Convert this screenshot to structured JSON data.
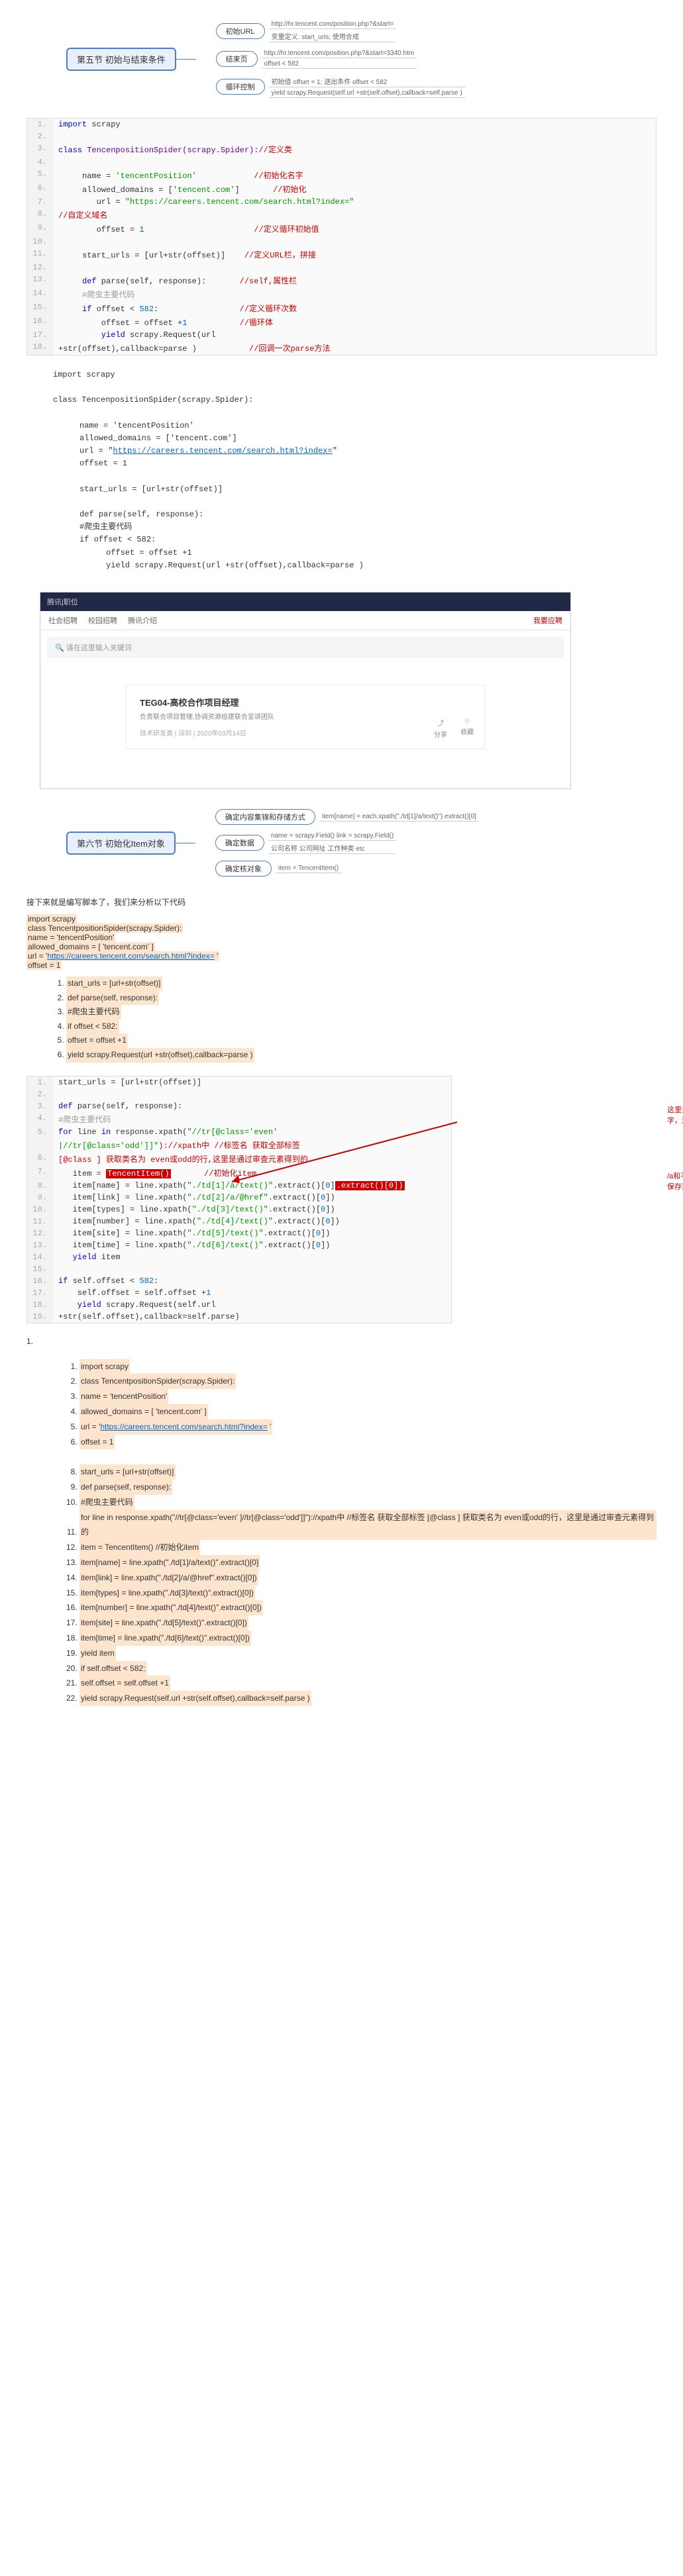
{
  "mindmap1": {
    "root": "第五节 初始与结束条件",
    "n1": "初始URL",
    "n1s1": "http://hr.tencent.com/position.php?&start=",
    "n1s2": "变量定义: start_urls; 使用合成",
    "n2": "结束页",
    "n2s1": "http://hr.tencent.com/position.php?&start=3340.htm",
    "n2s2": "offset < 582",
    "n3": "循环控制",
    "n3s1": "初始值 offset = 1; 送出条件 offset < 582",
    "n3s2": "yield scrapy.Request(self.url +str(self.offset),callback=self.parse )"
  },
  "code1": {
    "l1a": "import",
    "l1b": " scrapy",
    "l3a": "class",
    "l3b": " TencenpositionSpider(scrapy.Spider):",
    "l3c": "//定义类",
    "l5a": "     name = ",
    "l5b": "'tencentPosition'",
    "l5c": "//初始化名字",
    "l6a": "     allowed_domains = [",
    "l6b": "'tencent.com'",
    "l6c": "]       ",
    "l6d": "//初始化",
    "l7a": "        url = ",
    "l7b": "\"https://careers.tencent.com/search.html?index=\"",
    "l8a": "//自定义域名",
    "l9a": "        offset = ",
    "l9b": "1",
    "l9c": "                       ",
    "l9d": "//定义循环初始值",
    "l11a": "     start_urls = [url+str(offset)]    ",
    "l11b": "//定义URL栏，拼接",
    "l13a": "     def",
    "l13b": " parse(self, response):       ",
    "l13c": "//self,属性栏",
    "l14a": "     #爬虫主要代码",
    "l15a": "     if",
    "l15b": " offset < ",
    "l15c": "582",
    "l15d": ":                 ",
    "l15e": "//定义循环次数",
    "l16a": "         offset = offset +",
    "l16b": "1",
    "l16c": "           ",
    "l16d": "//循环体",
    "l17a": "         yield",
    "l17b": " scrapy.Request(url",
    "l18a": "+str(offset),callback=parse )           ",
    "l18b": "//回调一次parse方法"
  },
  "plaincode1": {
    "l1": "import scrapy",
    "l2": "class TencenpositionSpider(scrapy.Spider):",
    "l3": "name = 'tencentPosition'",
    "l4": "allowed_domains = ['tencent.com']",
    "l5pre": "url = \"",
    "l5link": "https://careers.tencent.com/search.html?index=",
    "l5post": "\"",
    "l6": "offset = 1",
    "l7": "start_urls = [url+str(offset)]",
    "l8": "def parse(self, response):",
    "l9": "#爬虫主要代码",
    "l10": "if offset < 582:",
    "l11": "offset = offset +1",
    "l12": "yield scrapy.Request(url +str(offset),callback=parse )"
  },
  "browser": {
    "tab": "腾讯|职位",
    "menu1": "社会招聘",
    "menu2": "校园招聘",
    "menu3": "腾讯介绍",
    "btn": "我要应聘",
    "search": "请在这里输入关键词",
    "card_title": "TEG04-高校合作项目经理",
    "card_desc": "负责联合项目管理,协调资源组建联合宣讲团队",
    "card_meta": "技术研发类 | 深圳 | 2020年03月14日",
    "icon1": "分享",
    "icon2": "收藏"
  },
  "mindmap2": {
    "root": "第六节 初始化Item对象",
    "n1": "确定内容集锦和存储方式",
    "n1s1": "item[name] = each.xpath(\"./td[1]/a/text()\").extract()[0]",
    "n2": "确定数据",
    "n2s1": "name = scrapy.Field() link = scrapy.Field()",
    "n2s2": "公司名称 公司网址 工作种类 etc",
    "n3": "确定核对象",
    "n3s1": "item = TencentItem()"
  },
  "para1": "接下来就是编写脚本了，我们来分析以下代码",
  "hlblock": {
    "l1": "import scrapy",
    "l2": "class TencentpositionSpider(scrapy.Spider):",
    "l3": "name = 'tencentPosition'",
    "l4": "allowed_domains = [ 'tencent.com' ]",
    "l5a": "url = '",
    "l5b": "https://careers.tencent.com/search.html?index=",
    "l5c": " '",
    "l6": "offset = 1"
  },
  "steps1": {
    "s1": "start_urls = [url+str(offset)]",
    "s2": "def parse(self, response):",
    "s3": "#爬虫主要代码",
    "s4": "if offset < 582:",
    "s5": "offset = offset +1",
    "s6": "yield scrapy.Request(url +str(offset),callback=parse )"
  },
  "code2": {
    "l1": "start_urls = [url+str(offset)]",
    "l3a": "def",
    "l3b": " parse(self, response):",
    "l4": "#爬虫主要代码",
    "l5a": "for",
    "l5b": " line ",
    "l5c": "in",
    "l5d": " response.xpath(",
    "l5e": "\"//tr[@class='even'",
    "l6a": "|//tr[@class='odd']]\"",
    "l6b": ")://xpath中 //标签名 获取全部标签",
    "l6c": "[@class ] 获取类名为 even或odd的行",
    "l6d": ",这里是通过审查元素得到的",
    "l7a": "   item = ",
    "l7b": "TencentItem()",
    "l7c": "       //初始化item",
    "l8a": "   item[name] = line.xpath(",
    "l8b": "\"./td[1]/a/text()\"",
    "l8c": ".extract()[",
    "l8d": "0",
    "l8e": "]",
    "l9a": "   item[link] = line.xpath(",
    "l9b": "\"./td[2]/a/@href\"",
    "l9c": ".extract()[",
    "l9d": "0",
    "l9e": "])",
    "l10a": "   item[types] = line.xpath(",
    "l10b": "\"./td[3]/text()\"",
    "l10c": ".extract()[",
    "l10d": "0",
    "l10e": "])",
    "l11a": "   item[number] = line.xpath(",
    "l11b": "\"./td[4]/text()\"",
    "l11c": ".extract()[",
    "l11d": "0",
    "l11e": "])",
    "l12a": "   item[site] = line.xpath(",
    "l12b": "\"./td[5]/text()\"",
    "l12c": ".extract()[",
    "l12d": "0",
    "l12e": "])",
    "l13a": "   item[time] = line.xpath(",
    "l13b": "\"./td[6]/text()\"",
    "l13c": ".extract()[",
    "l13d": "0",
    "l13e": "])",
    "l14a": "   yield",
    "l14b": " item",
    "l16a": "if",
    "l16b": " self.offset < ",
    "l16c": "582",
    "l16d": ":",
    "l17a": "    self.offset = self.offset +",
    "l17b": "1",
    "l18a": "    yield",
    "l18b": " scrapy.Request(self.url",
    "l19": "+str(self.offset),callback=self.parse)"
  },
  "anno1": "这里是之前的Item.py文件中的配置好的名字，这里我们直接调用存储爬取的数据",
  "anno2": "/a和不/a这里是审查元素得到的如果是链接要保存到@href的格式",
  "bignum": "1.",
  "final": {
    "s1": "import scrapy",
    "s2": "class TencentpositionSpider(scrapy.Spider):",
    "s3": "name = 'tencentPosition'",
    "s4": "allowed_domains = [ 'tencent.com' ]",
    "s5a": "url = '",
    "s5b": "https://careers.tencent.com/search.html?index=",
    "s5c": " '",
    "s6": "offset = 1",
    "s7": "start_urls = [url+str(offset)]",
    "s8": "def parse(self, response):",
    "s9": "#爬虫主要代码",
    "s10": "for line in response.xpath(\"//tr[@class='even' ]//tr[@class='odd']]\")://xpath中 //标签名 获取全部标签        [@class ] 获取类名为 even或odd的行，这里是通过审查元素得到的",
    "s11": "item = TencentItem()       //初始化item",
    "s12": "item[name] = line.xpath(\"./td[1]/a/text()\".extract()[0]",
    "s13": "item[link] = line.xpath(\"./td[2]/a/@href\".extract()[0])",
    "s14": "item[types] = line.xpath(\"./td[3]/text()\".extract()[0])",
    "s15": "item[number] = line.xpath(\"./td[4]/text()\".extract()[0])",
    "s16": "item[site] = line.xpath(\"./td[5]/text()\".extract()[0])",
    "s17": "item[time] = line.xpath(\"./td[6]/text()\".extract()[0])",
    "s18": "yield item",
    "s19": "if self.offset < 582:",
    "s20": "self.offset = self.offset +1",
    "s21": "yield scrapy.Request(self.url +str(self.offset),callback=self.parse )"
  }
}
